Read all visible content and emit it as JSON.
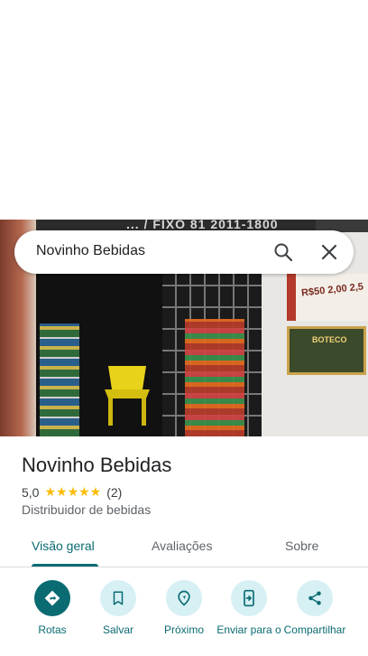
{
  "search": {
    "query": "Novinho Bebidas"
  },
  "photo": {
    "sign_text": "... / FIXO  81 2011-1800",
    "poster1_text": "R$50 2,00 2,5",
    "poster2_text": "BOTECO"
  },
  "place": {
    "name": "Novinho Bebidas",
    "rating": "5,0",
    "stars": "★★★★★",
    "review_count": "(2)",
    "category": "Distribuidor de bebidas"
  },
  "tabs": [
    {
      "label": "Visão geral",
      "active": true
    },
    {
      "label": "Avaliações",
      "active": false
    },
    {
      "label": "Sobre",
      "active": false
    }
  ],
  "actions": [
    {
      "label": "Rotas",
      "icon": "directions-icon"
    },
    {
      "label": "Salvar",
      "icon": "bookmark-icon"
    },
    {
      "label": "Próximo",
      "icon": "nearby-icon"
    },
    {
      "label": "Enviar para o",
      "icon": "send-to-phone-icon"
    },
    {
      "label": "Compartilhar",
      "icon": "share-icon"
    }
  ],
  "colors": {
    "accent": "#0b6b72",
    "accent_light": "#d6f0f4",
    "star": "#fbbc04",
    "text_primary": "#202124",
    "text_secondary": "#5f6368"
  }
}
